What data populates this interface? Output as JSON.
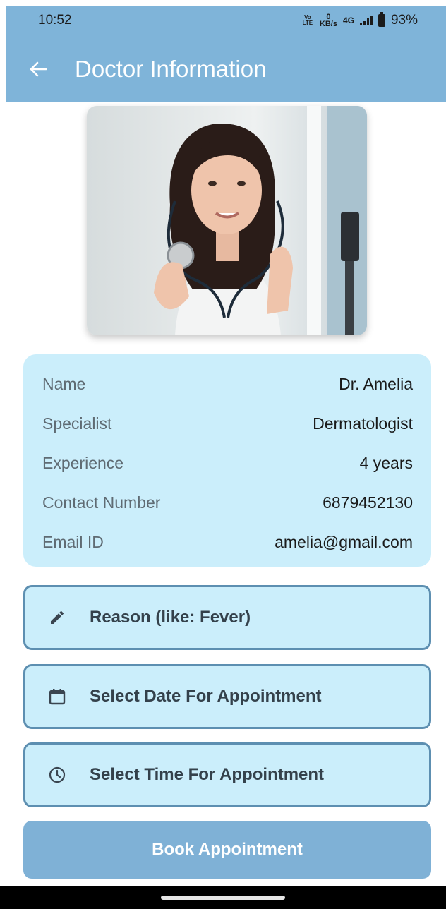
{
  "status_bar": {
    "time": "10:52",
    "volte": "Vo LTE",
    "speed_value": "0",
    "speed_unit": "KB/s",
    "network": "4G",
    "battery": "93%"
  },
  "app_bar": {
    "title": "Doctor Information",
    "back_icon": "arrow-left-icon",
    "color": "#7fb4d9"
  },
  "doctor": {
    "photo": "doctor-with-stethoscope",
    "details": [
      {
        "label": "Name",
        "value": "Dr. Amelia"
      },
      {
        "label": "Specialist",
        "value": "Dermatologist"
      },
      {
        "label": "Experience",
        "value": "4 years"
      },
      {
        "label": "Contact Number",
        "value": "6879452130"
      },
      {
        "label": "Email ID",
        "value": "amelia@gmail.com"
      }
    ]
  },
  "form": {
    "reason": {
      "label": "Reason (like: Fever)",
      "icon": "pencil-icon"
    },
    "date": {
      "label": "Select Date For Appointment",
      "icon": "calendar-icon"
    },
    "time": {
      "label": "Select Time For Appointment",
      "icon": "clock-icon"
    }
  },
  "book_button": {
    "label": "Book Appointment"
  },
  "colors": {
    "accent": "#7fb4d9",
    "card": "#cbeefb",
    "field_border": "#5d8fb1"
  }
}
